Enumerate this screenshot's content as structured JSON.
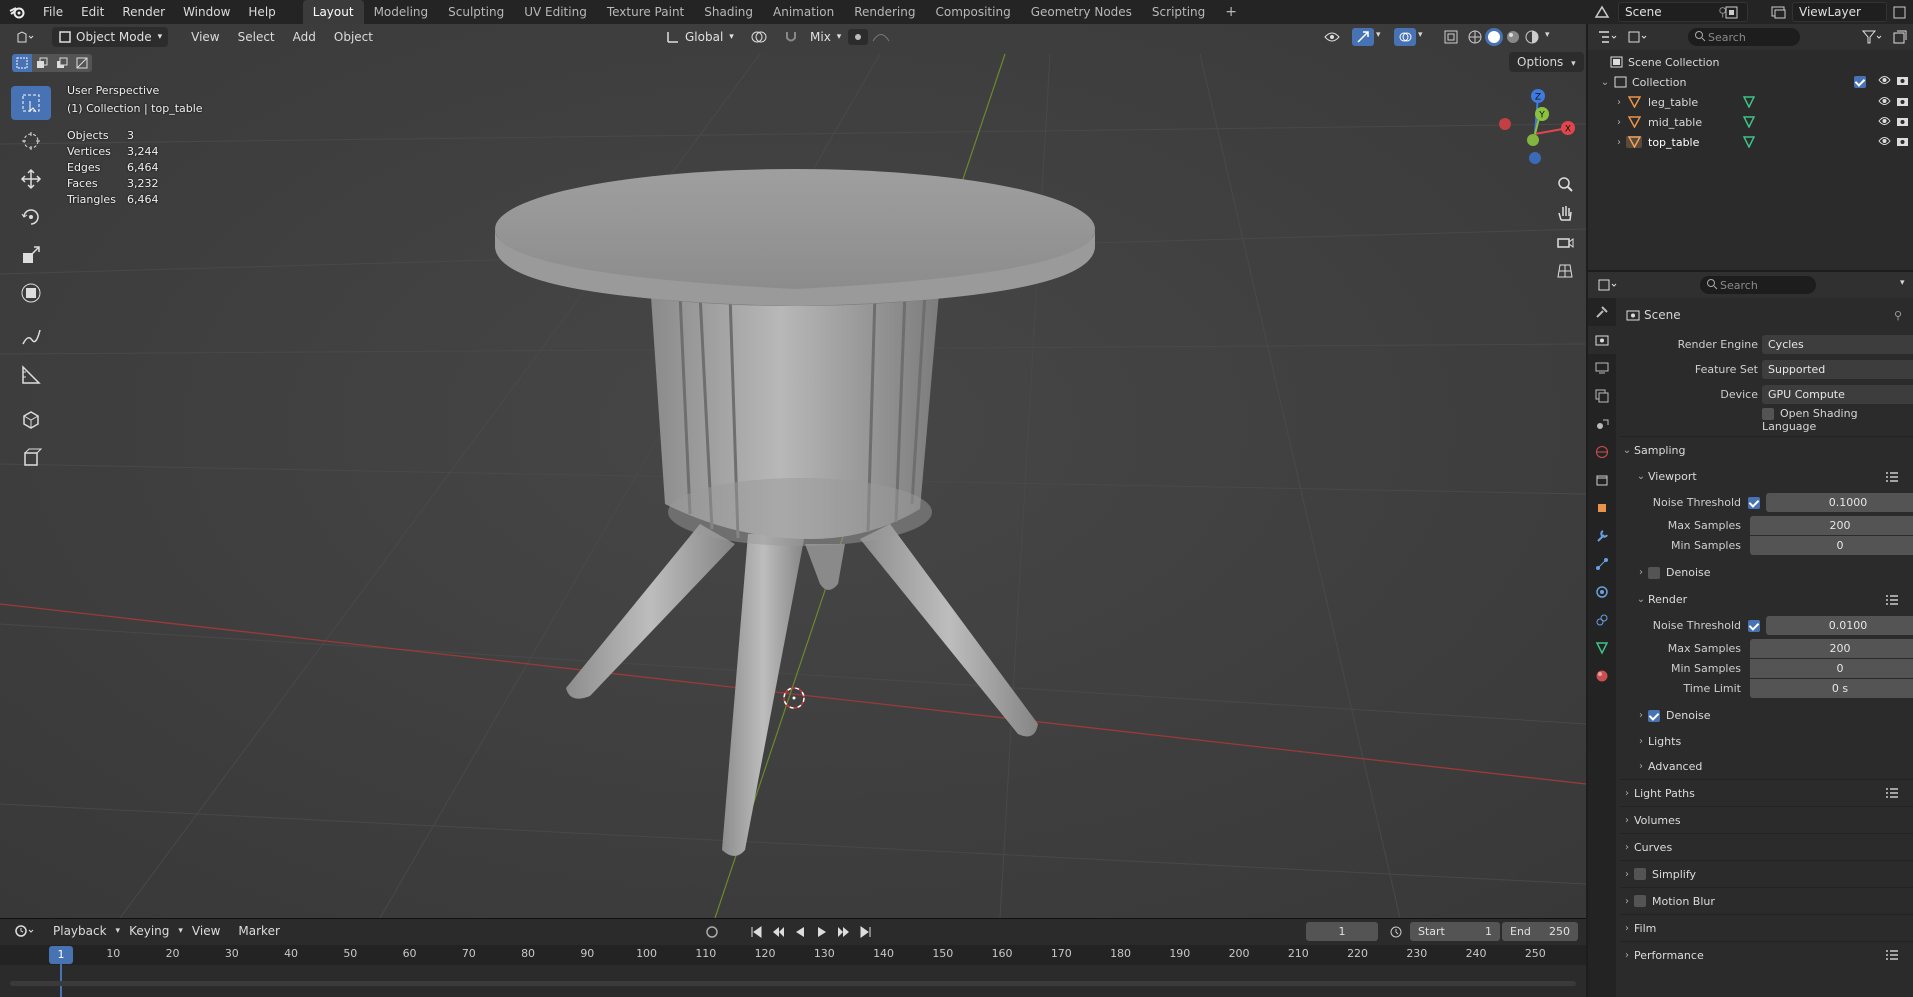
{
  "topbar": {
    "menus": [
      "File",
      "Edit",
      "Render",
      "Window",
      "Help"
    ],
    "workspaces": [
      "Layout",
      "Modeling",
      "Sculpting",
      "UV Editing",
      "Texture Paint",
      "Shading",
      "Animation",
      "Rendering",
      "Compositing",
      "Geometry Nodes",
      "Scripting"
    ],
    "active_workspace": "Layout",
    "add_workspace": "+",
    "scene_name": "Scene",
    "view_layer": "ViewLayer"
  },
  "viewport": {
    "mode": "Object Mode",
    "menus": [
      "View",
      "Select",
      "Add",
      "Object"
    ],
    "transform_orientation": "Global",
    "snap_mode": "Mix",
    "options_label": "Options",
    "view_name": "User Perspective",
    "collection_info": "(1) Collection | top_table",
    "stats": [
      {
        "label": "Objects",
        "value": "3"
      },
      {
        "label": "Vertices",
        "value": "3,244"
      },
      {
        "label": "Edges",
        "value": "6,464"
      },
      {
        "label": "Faces",
        "value": "3,232"
      },
      {
        "label": "Triangles",
        "value": "6,464"
      }
    ],
    "gizmo_axes": {
      "z": "Z",
      "y": "Y",
      "x": "X"
    },
    "colors": {
      "x_axis": "#e0464c",
      "y_axis": "#8ac23f",
      "z_axis": "#3d7be0",
      "active_tool": "#4772b3",
      "grid_bg": "#3d3d3d"
    }
  },
  "timeline": {
    "menus": [
      "Playback",
      "Keying",
      "View",
      "Marker"
    ],
    "current_frame": "1",
    "start_label": "Start",
    "start": "1",
    "end_label": "End",
    "end": "250",
    "ticks": [
      "10",
      "20",
      "30",
      "40",
      "50",
      "60",
      "70",
      "80",
      "90",
      "100",
      "110",
      "120",
      "130",
      "140",
      "150",
      "160",
      "170",
      "180",
      "190",
      "200",
      "210",
      "220",
      "230",
      "240",
      "250"
    ],
    "playhead_frame": "1"
  },
  "outliner": {
    "search_placeholder": "Search",
    "scene_collection": "Scene Collection",
    "collection": "Collection",
    "objects": [
      "leg_table",
      "mid_table",
      "top_table"
    ]
  },
  "properties": {
    "search_placeholder": "Search",
    "context": "Scene",
    "render_engine_label": "Render Engine",
    "render_engine": "Cycles",
    "feature_set_label": "Feature Set",
    "feature_set": "Supported",
    "device_label": "Device",
    "device": "GPU Compute",
    "osl_label": "Open Shading Language",
    "sampling": "Sampling",
    "viewport_section": "Viewport",
    "noise_threshold_label": "Noise Threshold",
    "viewport_noise": "0.1000",
    "max_samples_label": "Max Samples",
    "viewport_max": "200",
    "min_samples_label": "Min Samples",
    "viewport_min": "0",
    "denoise_label": "Denoise",
    "render_section": "Render",
    "render_noise": "0.0100",
    "render_max": "200",
    "render_min": "0",
    "time_limit_label": "Time Limit",
    "time_limit": "0 s",
    "lights": "Lights",
    "advanced": "Advanced",
    "light_paths": "Light Paths",
    "volumes": "Volumes",
    "curves": "Curves",
    "simplify": "Simplify",
    "motion_blur": "Motion Blur",
    "film": "Film",
    "performance": "Performance"
  }
}
